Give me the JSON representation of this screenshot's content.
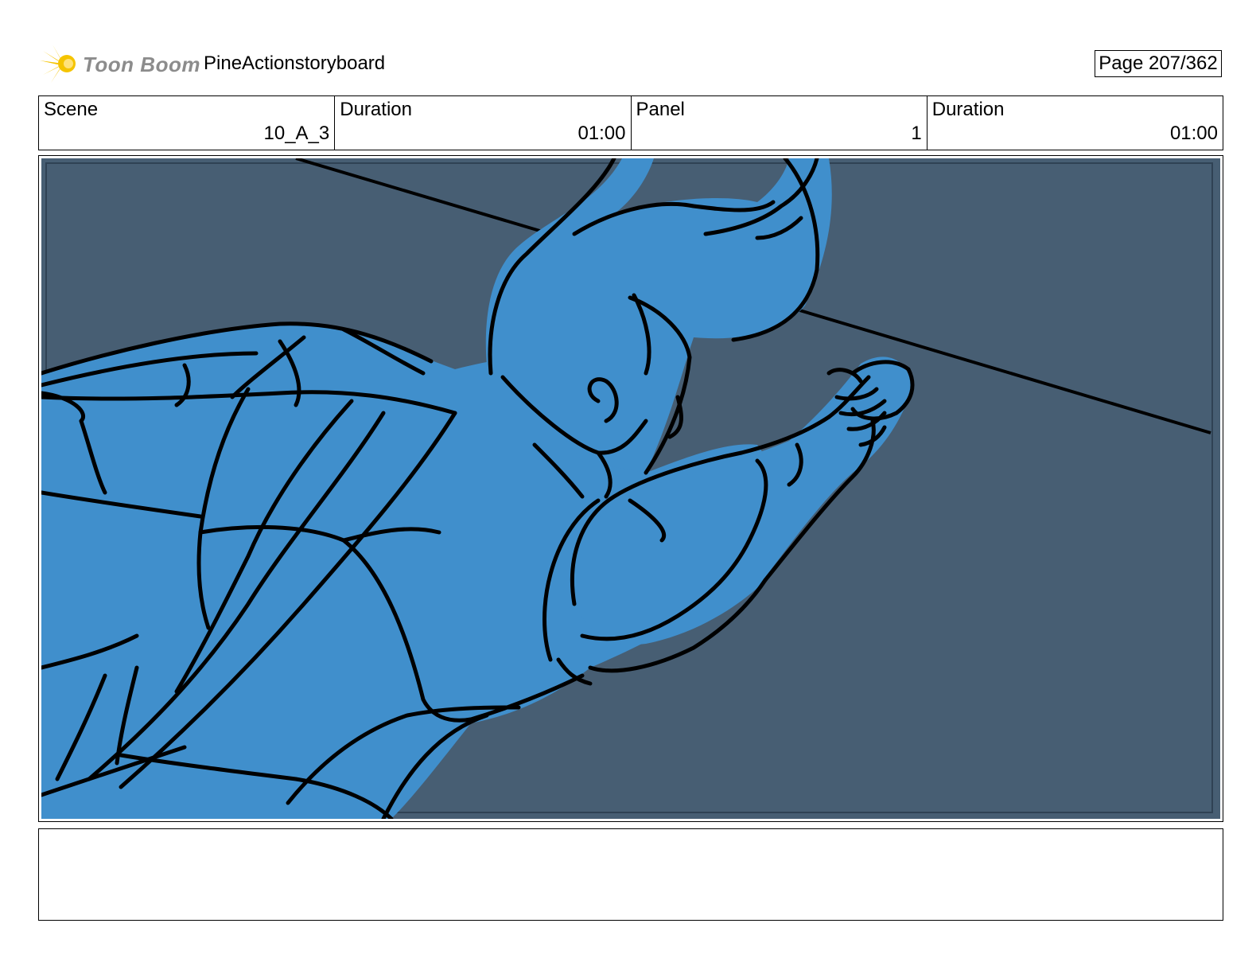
{
  "header": {
    "logo_text": "Toon Boom",
    "project_title": "PineActionstoryboard",
    "page_indicator": "Page 207/362"
  },
  "info": {
    "scene_label": "Scene",
    "scene_value": "10_A_3",
    "scene_duration_label": "Duration",
    "scene_duration_value": "01:00",
    "panel_label": "Panel",
    "panel_value": "1",
    "panel_duration_label": "Duration",
    "panel_duration_value": "01:00"
  },
  "colors": {
    "background": "#475e73",
    "character_fill": "#408fcc",
    "line": "#000000",
    "logo_accent": "#f5c400",
    "logo_text": "#8c8c8c"
  },
  "notes": {
    "text": ""
  }
}
